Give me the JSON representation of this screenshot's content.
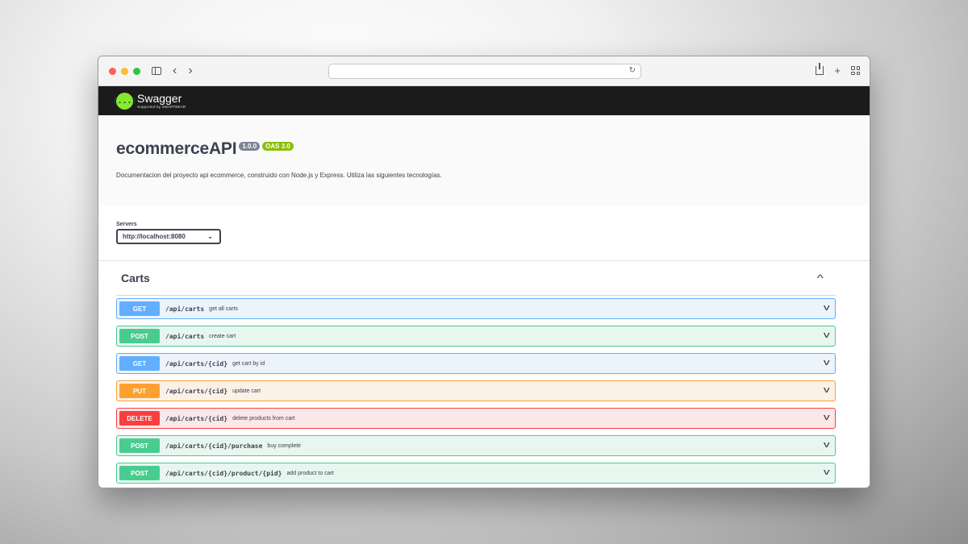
{
  "browser": {
    "dot_colors": [
      "#ff5f57",
      "#febc2e",
      "#28c840"
    ],
    "url": ""
  },
  "swagger": {
    "logo_glyph": "{...}",
    "name": "Swagger",
    "sub": "Supported by SMARTBEAR"
  },
  "info": {
    "title": "ecommerceAPI",
    "version": "1.0.0",
    "oas": "OAS 3.0",
    "description": "Documentacion del proyecto api ecommerce, construido con Node.js y Express. Utiliza las siguientes tecnologías."
  },
  "servers": {
    "label": "Servers",
    "selected": "http://localhost:8080"
  },
  "tag": {
    "name": "Carts",
    "operations": [
      {
        "method": "GET",
        "path": "/api/carts",
        "summary": "get all carts"
      },
      {
        "method": "POST",
        "path": "/api/carts",
        "summary": "create cart"
      },
      {
        "method": "GET",
        "path": "/api/carts/{cid}",
        "summary": "get cart by id"
      },
      {
        "method": "PUT",
        "path": "/api/carts/{cid}",
        "summary": "update cart"
      },
      {
        "method": "DELETE",
        "path": "/api/carts/{cid}",
        "summary": "delete products from cart"
      },
      {
        "method": "POST",
        "path": "/api/carts/{cid}/purchase",
        "summary": "buy complete"
      },
      {
        "method": "POST",
        "path": "/api/carts/{cid}/product/{pid}",
        "summary": "add product to cart"
      }
    ]
  },
  "method_colors": {
    "GET": {
      "bg": "#61affe",
      "tint": "#ebf3fb",
      "border": "#61affe"
    },
    "POST": {
      "bg": "#49cc90",
      "tint": "#e8f6f0",
      "border": "#49cc90"
    },
    "PUT": {
      "bg": "#fca130",
      "tint": "#fbf1e6",
      "border": "#fca130"
    },
    "DELETE": {
      "bg": "#f93e3e",
      "tint": "#fae7e7",
      "border": "#f93e3e"
    }
  }
}
